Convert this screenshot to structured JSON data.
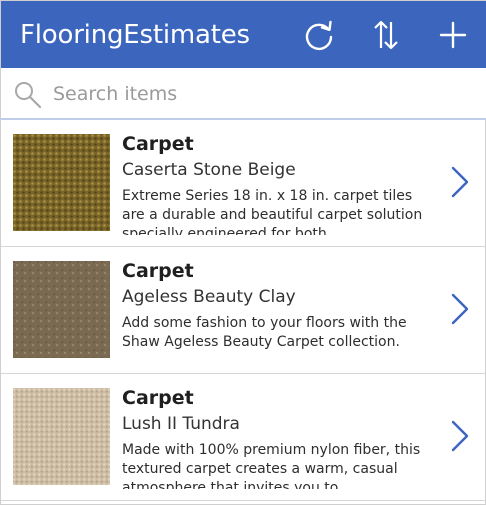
{
  "header": {
    "title": "FlooringEstimates",
    "background_color": "#3c65be",
    "actions": [
      {
        "icon": "refresh-icon"
      },
      {
        "icon": "sort-icon"
      },
      {
        "icon": "add-icon"
      }
    ]
  },
  "search": {
    "placeholder": "Search items",
    "value": "",
    "icon": "search-icon"
  },
  "items": [
    {
      "title": "Carpet",
      "subtitle": "Caserta Stone Beige",
      "description": "Extreme Series 18 in. x 18 in. carpet tiles are a durable and beautiful carpet solution specially engineered for both",
      "image": "carpet-swatch-olive",
      "swatch_color": "#7a6528"
    },
    {
      "title": "Carpet",
      "subtitle": "Ageless Beauty Clay",
      "description": "Add some fashion to your floors with the Shaw Ageless Beauty Carpet collection.",
      "image": "carpet-swatch-clay",
      "swatch_color": "#7a6a52"
    },
    {
      "title": "Carpet",
      "subtitle": "Lush II Tundra",
      "description": "Made with 100% premium nylon fiber, this textured carpet creates a warm, casual atmosphere that invites you to",
      "image": "carpet-swatch-tundra",
      "swatch_color": "#cdbda5"
    }
  ]
}
